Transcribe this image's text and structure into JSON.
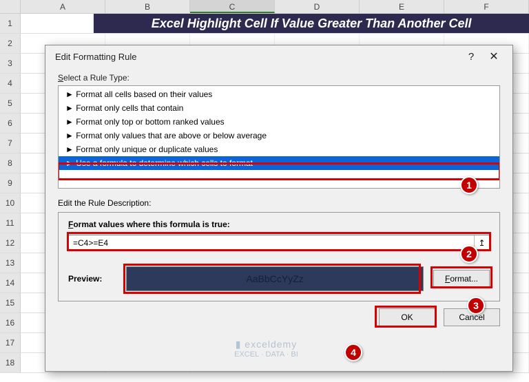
{
  "sheet": {
    "columns": [
      "A",
      "B",
      "C",
      "D",
      "E",
      "F"
    ],
    "selected_column": "C",
    "rows": [
      1,
      2,
      3,
      4,
      5,
      6,
      7,
      8,
      9,
      10,
      11,
      12,
      13,
      14,
      15,
      16,
      17,
      18
    ],
    "title_cell": "Excel Highlight Cell If Value Greater Than Another Cell"
  },
  "dialog": {
    "title": "Edit Formatting Rule",
    "help": "?",
    "close": "✕",
    "select_label_pre": "S",
    "select_label": "elect a Rule Type:",
    "rule_types": [
      "► Format all cells based on their values",
      "► Format only cells that contain",
      "► Format only top or bottom ranked values",
      "► Format only values that are above or below average",
      "► Format only unique or duplicate values",
      "► Use a formula to determine which cells to format"
    ],
    "selected_rule_index": 5,
    "edit_desc_label": "Edit the Rule Description:",
    "formula_title_pre": "F",
    "formula_title": "ormat values where this formula is true:",
    "formula_value": "=C4>=E4",
    "picker_glyph": "↥",
    "preview_label": "Preview:",
    "preview_sample": "AaBbCcYyZz",
    "format_btn_pre": "F",
    "format_btn": "ormat...",
    "ok": "OK",
    "cancel": "Cancel"
  },
  "badges": {
    "b1": "1",
    "b2": "2",
    "b3": "3",
    "b4": "4"
  },
  "watermark": {
    "brand": "exceldemy",
    "tag": "EXCEL · DATA · BI"
  },
  "colors": {
    "highlight": "#d80000",
    "badge": "#c30000",
    "selection": "#0b64d8",
    "title_bg": "#2e294e",
    "preview_bg": "#2e3a5c"
  }
}
